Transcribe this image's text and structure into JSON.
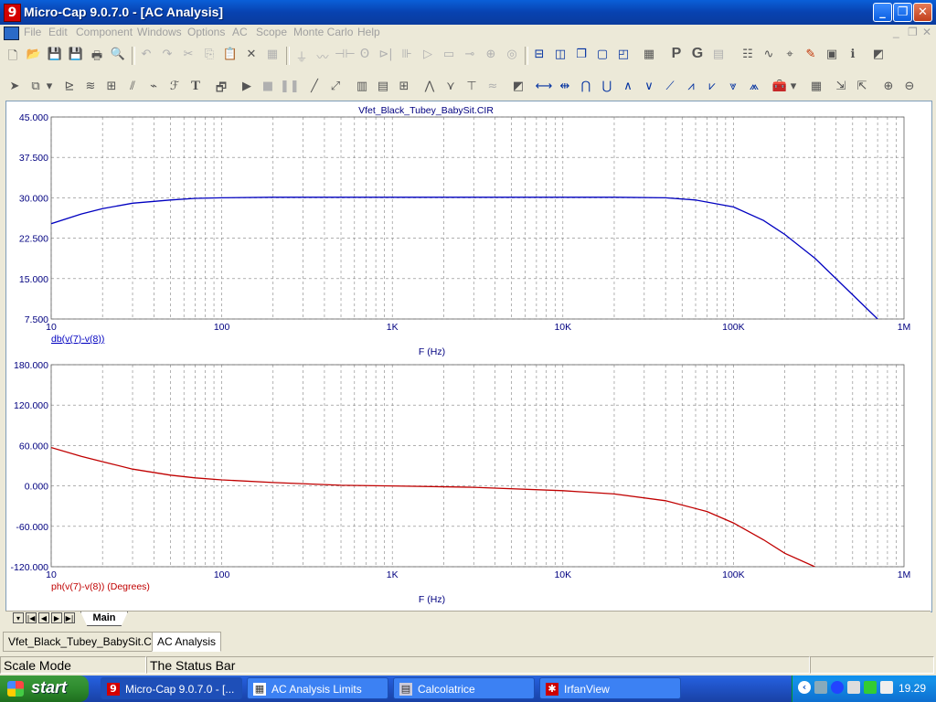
{
  "window": {
    "title": "Micro-Cap 9.0.7.0 - [AC Analysis]",
    "app_icon": "micro-cap-icon",
    "controls": [
      "_",
      "❐",
      "✕"
    ]
  },
  "menu": {
    "items": [
      "File",
      "Edit",
      "Component",
      "Windows",
      "Options",
      "AC",
      "Scope",
      "Monte Carlo",
      "Help"
    ],
    "mdi_controls": [
      "_",
      "❐",
      "✕"
    ]
  },
  "plot": {
    "title": "Vfet_Black_Tubey_BabySit.CIR",
    "colors": {
      "magnitude": "#0000c0",
      "phase": "#c00000",
      "grid": "#808080",
      "axis_text": "#000080"
    }
  },
  "chart_data": [
    {
      "type": "line",
      "x_scale": "log",
      "xlim": [
        10,
        1000000
      ],
      "ylim": [
        7.5,
        45
      ],
      "x_tick_labels": [
        "10",
        "100",
        "1K",
        "10K",
        "100K",
        "1M"
      ],
      "y_tick_labels": [
        "45.000",
        "37.500",
        "30.000",
        "22.500",
        "15.000",
        "7.500"
      ],
      "xlabel": "F (Hz)",
      "grid": true,
      "series": [
        {
          "name": "db(v(7)-v(8))",
          "color": "#0000c0",
          "x": [
            10,
            15,
            20,
            30,
            50,
            70,
            100,
            200,
            500,
            1000,
            5000,
            10000,
            20000,
            40000,
            60000,
            100000,
            150000,
            200000,
            300000,
            500000,
            700000
          ],
          "y": [
            25.2,
            27.0,
            28.0,
            29.0,
            29.6,
            29.9,
            30.0,
            30.1,
            30.1,
            30.1,
            30.1,
            30.1,
            30.1,
            30.0,
            29.6,
            28.3,
            25.8,
            23.2,
            18.8,
            12.0,
            7.5
          ]
        }
      ]
    },
    {
      "type": "line",
      "x_scale": "log",
      "xlim": [
        10,
        1000000
      ],
      "ylim": [
        -120,
        180
      ],
      "x_tick_labels": [
        "10",
        "100",
        "1K",
        "10K",
        "100K",
        "1M"
      ],
      "y_tick_labels": [
        "180.000",
        "120.000",
        "60.000",
        "0.000",
        "-60.000",
        "-120.000"
      ],
      "xlabel": "F (Hz)",
      "grid": true,
      "series": [
        {
          "name": "ph(v(7)-v(8)) (Degrees)",
          "color": "#c00000",
          "x": [
            10,
            15,
            20,
            30,
            50,
            70,
            100,
            200,
            500,
            1000,
            3000,
            10000,
            20000,
            40000,
            70000,
            100000,
            150000,
            200000,
            300000
          ],
          "y": [
            57,
            44,
            36,
            25,
            16,
            12,
            9,
            5,
            1,
            0,
            -2,
            -7,
            -12,
            -22,
            -38,
            -55,
            -80,
            -100,
            -120
          ]
        }
      ]
    }
  ],
  "sheet_tabs": {
    "nav": [
      "▾",
      "|◀",
      "◀",
      "▶",
      "▶|"
    ],
    "active": "Main"
  },
  "window_tabs": [
    "Vfet_Black_Tubey_BabySit.CIR",
    "AC Analysis"
  ],
  "status": {
    "mode": "Scale Mode",
    "message": "The Status Bar"
  },
  "taskbar": {
    "start": "start",
    "tasks": [
      {
        "label": "Micro-Cap 9.0.7.0 - [...",
        "icon": "micro-cap-icon"
      },
      {
        "label": "AC Analysis Limits",
        "icon": "table-icon"
      },
      {
        "label": "Calcolatrice",
        "icon": "calculator-icon"
      },
      {
        "label": "IrfanView",
        "icon": "irfanview-icon"
      }
    ],
    "clock": "19.29"
  }
}
